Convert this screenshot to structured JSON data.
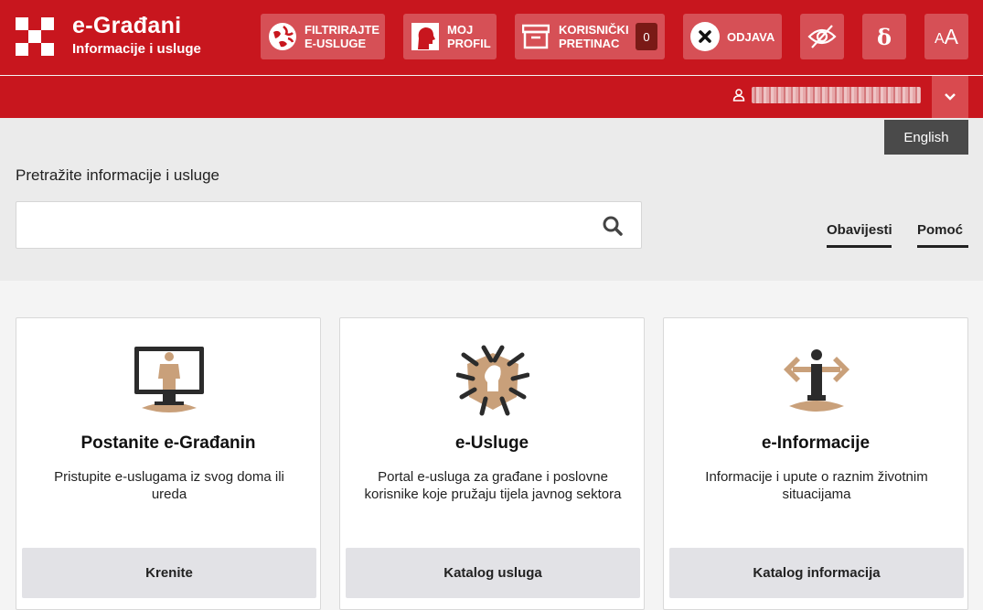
{
  "brand": {
    "title": "e-Građani",
    "subtitle": "Informacije i usluge"
  },
  "header": {
    "filter_label": "FILTRIRAJTE\nE-USLUGE",
    "profile_label": "MOJ\nPROFIL",
    "inbox_label": "KORISNIČKI\nPRETINAC",
    "inbox_count": "0",
    "logout_label": "ODJAVA",
    "dyslexia_glyph": "ẟ",
    "font_size_small": "A",
    "font_size_large": "A"
  },
  "language": {
    "label": "English"
  },
  "search": {
    "label": "Pretražite informacije i usluge",
    "value": "",
    "placeholder": ""
  },
  "links": {
    "notifications": "Obavijesti",
    "help": "Pomoć"
  },
  "cards": [
    {
      "title": "Postanite e-Građanin",
      "description": "Pristupite e-uslugama iz svog doma ili ureda",
      "button": "Krenite"
    },
    {
      "title": "e-Usluge",
      "description": "Portal e-usluga za građane i poslovne korisnike koje pružaju tijela javnog sektora",
      "button": "Katalog usluga"
    },
    {
      "title": "e-Informacije",
      "description": "Informacije i upute o raznim životnim situacijama",
      "button": "Katalog informacija"
    }
  ],
  "colors": {
    "brand_red": "#c8161e",
    "illustration_tan": "#c9a07a",
    "illustration_dark": "#2b2b2b"
  }
}
